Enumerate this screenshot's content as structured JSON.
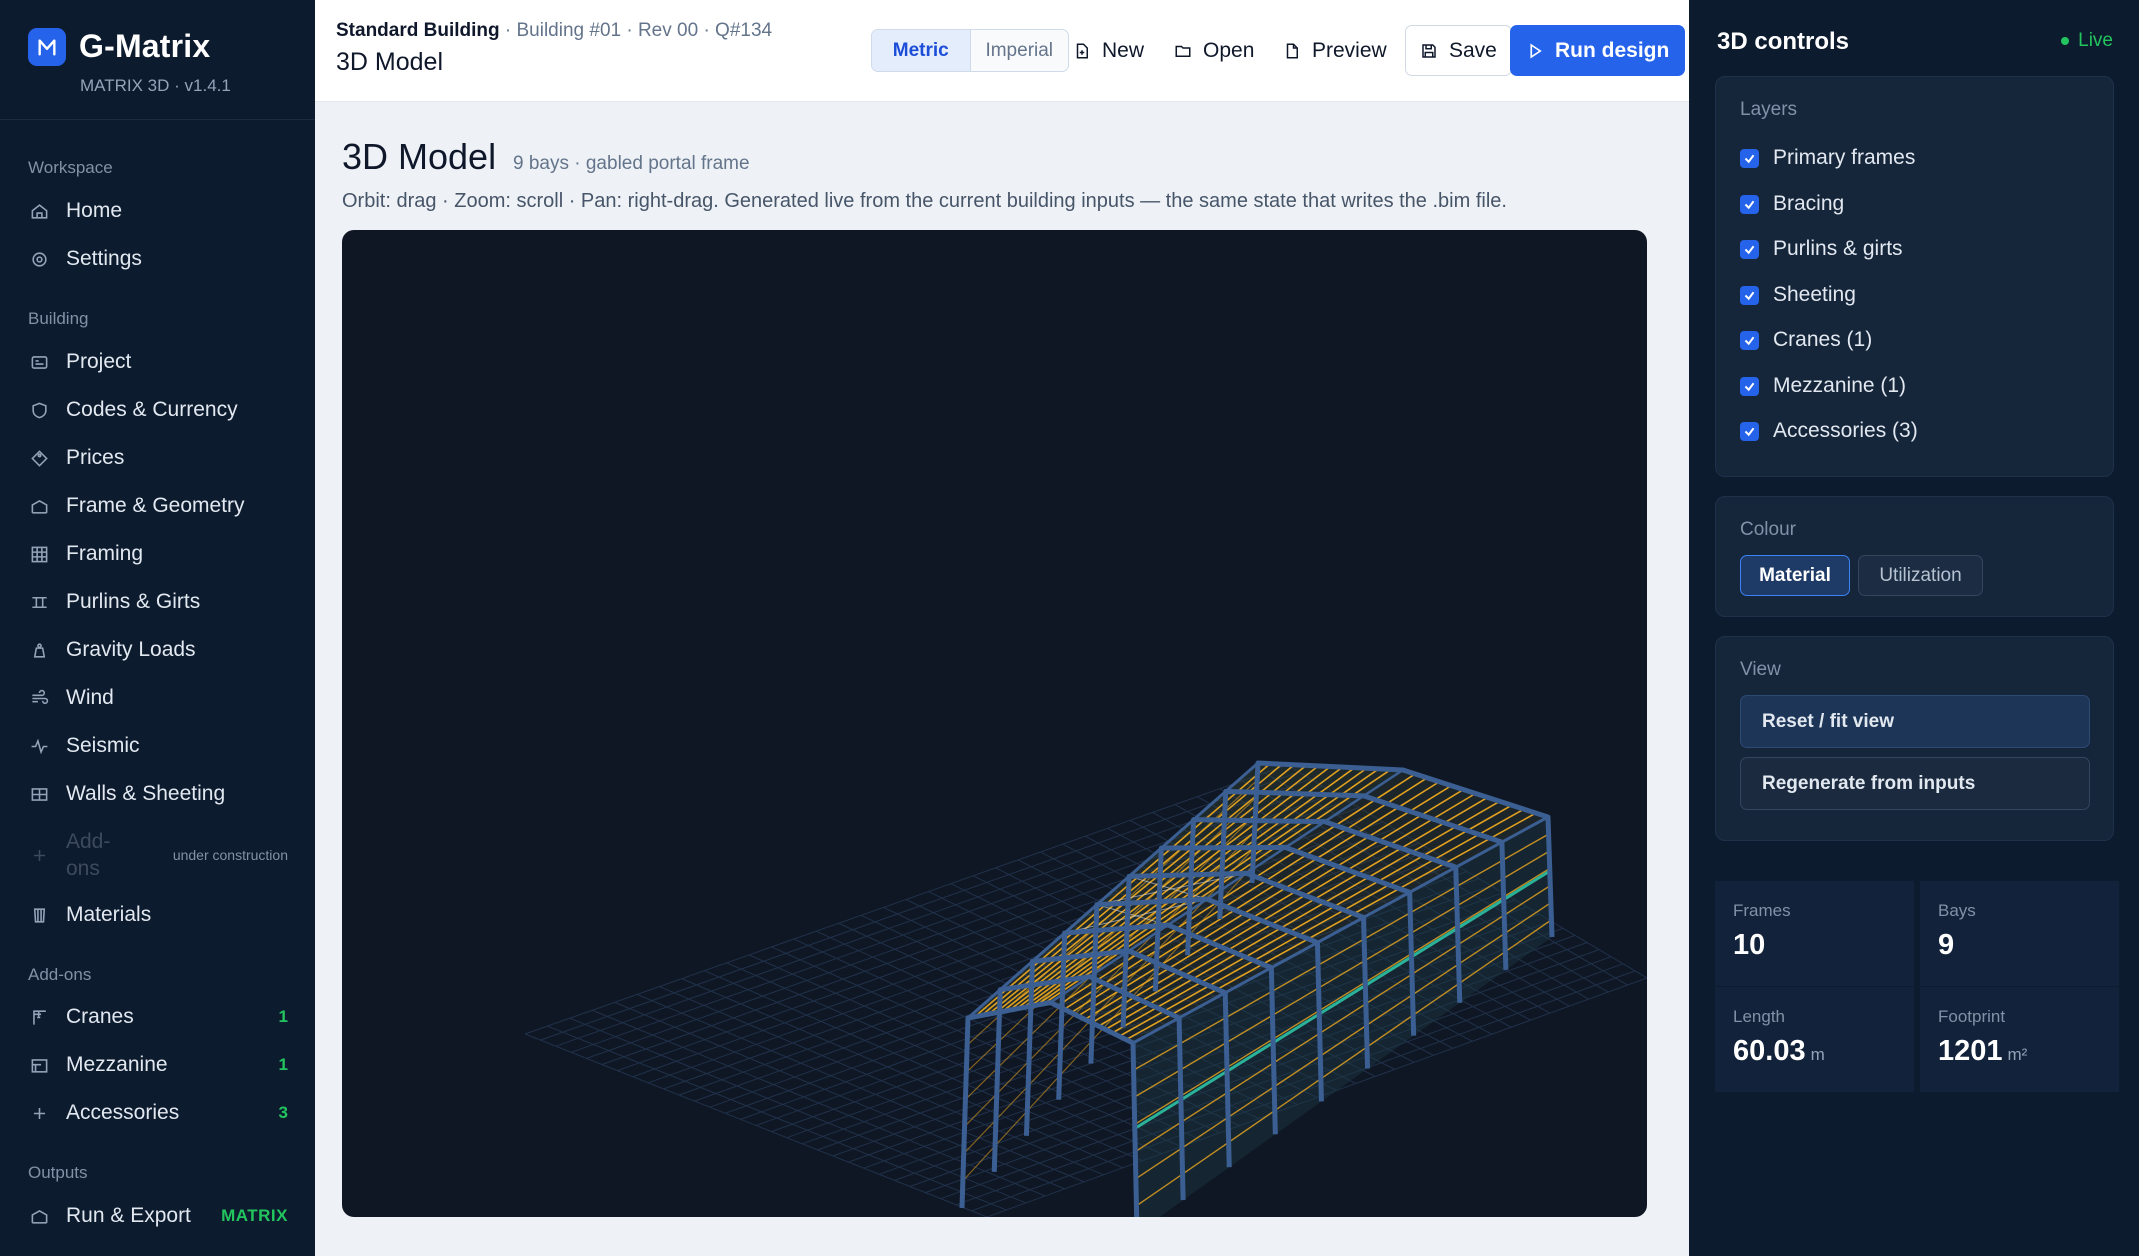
{
  "brand": {
    "name": "G-Matrix",
    "version": "MATRIX 3D · v1.4.1"
  },
  "sidebar": {
    "sections": {
      "workspace": "Workspace",
      "building": "Building",
      "addons": "Add-ons",
      "outputs": "Outputs"
    },
    "workspace_items": [
      {
        "label": "Home",
        "icon": "home-icon"
      },
      {
        "label": "Settings",
        "icon": "gear-icon"
      }
    ],
    "building_items": [
      {
        "label": "Project",
        "icon": "id-card-icon"
      },
      {
        "label": "Codes & Currency",
        "icon": "shield-icon"
      },
      {
        "label": "Prices",
        "icon": "tag-icon"
      },
      {
        "label": "Frame & Geometry",
        "icon": "frame-icon"
      },
      {
        "label": "Framing",
        "icon": "grid-icon"
      },
      {
        "label": "Purlins & Girts",
        "icon": "purlin-icon"
      },
      {
        "label": "Gravity Loads",
        "icon": "weight-icon"
      },
      {
        "label": "Wind",
        "icon": "wind-icon"
      },
      {
        "label": "Seismic",
        "icon": "pulse-icon"
      },
      {
        "label": "Walls & Sheeting",
        "icon": "wall-icon"
      }
    ],
    "addons_disabled": {
      "label": "Add-ons",
      "note": "under construction"
    },
    "materials": {
      "label": "Materials"
    },
    "addon_items": [
      {
        "label": "Cranes",
        "count": "1"
      },
      {
        "label": "Mezzanine",
        "count": "1"
      },
      {
        "label": "Accessories",
        "count": "3"
      }
    ],
    "output_items": [
      {
        "label": "Run & Export",
        "tag": "MATRIX"
      }
    ]
  },
  "header": {
    "crumb_building": "Standard Building",
    "crumb_rest": " · Building #01 · Rev 00 · Q#134",
    "title": "3D Model",
    "units": {
      "metric": "Metric",
      "imperial": "Imperial",
      "selected": "Metric"
    },
    "buttons": {
      "new": "New",
      "open": "Open",
      "preview": "Preview",
      "save": "Save",
      "run": "Run design"
    }
  },
  "main": {
    "title": "3D Model",
    "subtitle": "9 bays · gabled portal frame",
    "help": "Orbit: drag  ·  Zoom: scroll  ·  Pan: right‑drag. Generated live from the current building inputs — the same state that writes the .bim file."
  },
  "controls": {
    "title": "3D controls",
    "live": "Live",
    "layers_heading": "Layers",
    "layers": [
      {
        "label": "Primary frames",
        "checked": true
      },
      {
        "label": "Bracing",
        "checked": true
      },
      {
        "label": "Purlins & girts",
        "checked": true
      },
      {
        "label": "Sheeting",
        "checked": true
      },
      {
        "label": "Cranes (1)",
        "checked": true
      },
      {
        "label": "Mezzanine (1)",
        "checked": true
      },
      {
        "label": "Accessories (3)",
        "checked": true
      }
    ],
    "colour_heading": "Colour",
    "colour_options": {
      "material": "Material",
      "utilization": "Utilization",
      "selected": "Material"
    },
    "view_heading": "View",
    "view_buttons": {
      "reset": "Reset / fit view",
      "regenerate": "Regenerate from inputs"
    }
  },
  "stats": {
    "frames": {
      "label": "Frames",
      "value": "10"
    },
    "bays": {
      "label": "Bays",
      "value": "9"
    },
    "length": {
      "label": "Length",
      "value": "60.03",
      "unit": "m"
    },
    "footprint": {
      "label": "Footprint",
      "value": "1201",
      "unit": "m²"
    }
  },
  "colors": {
    "accent": "#2563eb",
    "live": "#22c55e",
    "sidebar_bg": "#0d1b2e",
    "viewport_bg": "#0f1724",
    "frame": "#3b5f93",
    "purlin": "#e0a020"
  }
}
